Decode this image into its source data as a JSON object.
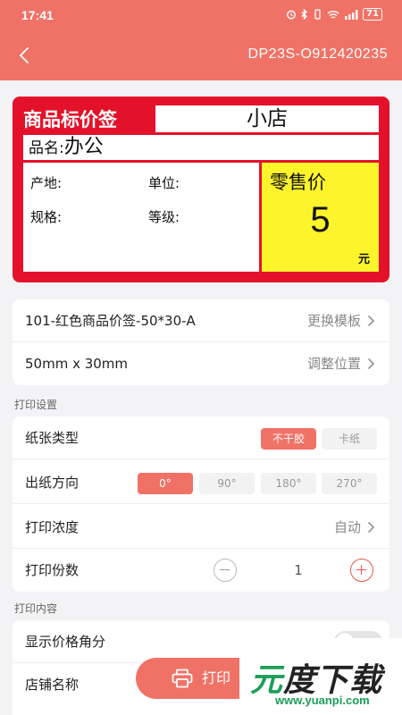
{
  "status_bar": {
    "time": "17:41",
    "battery": "71"
  },
  "header": {
    "device_name": "DP23S-O912420235"
  },
  "label_preview": {
    "title": "商品标价签",
    "shop": "小店",
    "name_key": "品名:",
    "name_value": "办公",
    "fields": [
      "产地:",
      "单位:",
      "规格:",
      "等级:"
    ],
    "price_title": "零售价",
    "price_value": "5",
    "price_unit": "元",
    "colors": {
      "frame": "#e3122a",
      "price_bg": "#fdf42b"
    }
  },
  "template": {
    "name": "101-红色商品价签-50*30-A",
    "change_label": "更换模板",
    "size": "50mm x 30mm",
    "adjust_label": "调整位置"
  },
  "print_settings": {
    "section_title": "打印设置",
    "paper_type_label": "纸张类型",
    "paper_types": [
      "不干胶",
      "卡纸"
    ],
    "paper_type_selected": "不干胶",
    "direction_label": "出纸方向",
    "directions": [
      "0°",
      "90°",
      "180°",
      "270°"
    ],
    "direction_selected": "0°",
    "density_label": "打印浓度",
    "density_value": "自动",
    "copies_label": "打印份数",
    "copies_value": "1"
  },
  "print_content": {
    "section_title": "打印内容",
    "show_cents_label": "显示价格角分",
    "show_cents_on": false,
    "shop_name_label": "店铺名称"
  },
  "actions": {
    "print_label": "打印"
  },
  "watermark": {
    "logo_green": "元",
    "logo_dark": "度下载",
    "logo_tail": "",
    "url": "www.yuanpi.com"
  },
  "theme": {
    "accent": "#f07266"
  }
}
